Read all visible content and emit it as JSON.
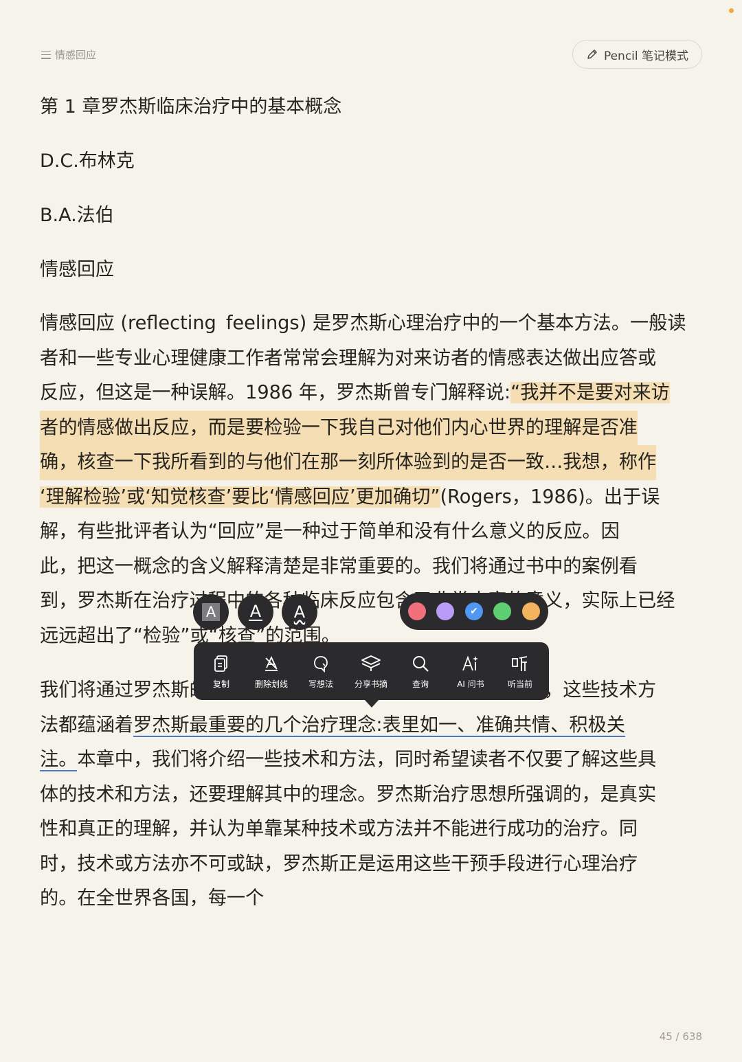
{
  "status": {
    "dot_color": "#f2a83b"
  },
  "header": {
    "chapter_label": "情感回应",
    "pencil_label": "Pencil 笔记模式"
  },
  "content": {
    "title": "第 1 章罗杰斯临床治疗中的基本概念",
    "author1": "D.C.布林克",
    "author2": "B.A.法伯",
    "section": "情感回应",
    "para1": [
      [
        "情感回应 (reflecting",
        "feelings) 是罗杰斯心理治疗中的一个基本方法。一般读"
      ],
      [
        "者和一些专业心理健康工作者常常会理解为对来访者的情感表达做出应答或"
      ],
      [
        "反应，但这是一种误解。1986 年，罗杰斯曾专门解释说:",
        "“我并不是要对来访"
      ],
      [
        "者的情感做出反应，而是要检验一下我自己对他们内心世界的理解是否准"
      ],
      [
        "确，核查一下我所看到的与他们在那一刻所体验到的是否一致…我想，称作"
      ],
      [
        "‘理解检验’或‘知觉核查’要比‘情感回应’更加确切”",
        "(Rogers，1986)。出于误"
      ],
      [
        "解，有些批评者认为“回应”是一种过于简单和没有什么意义的反应。因"
      ],
      [
        "此，把这一概念的含义解释清楚是非常重要的。我们将通过书中的案例看"
      ],
      [
        "到，罗杰斯在治疗过程中的各种临床反应包含了非常丰富的意义，实际上已经"
      ],
      [
        "远远超出了“检验”或“核查”的范围。"
      ]
    ],
    "para2": [
      [
        "我们将通过罗杰斯",
        "的治疗实例来说明罗杰斯的一些技术和概念，这些技术方"
      ],
      [
        "法都蕴涵着",
        "罗杰斯最重要的几个治疗理念:表里如一、准确共情、积极关"
      ],
      [
        "注。",
        "本章中，我们将介绍一些技术和方法，同时希望读者不仅要了解这些具"
      ],
      [
        "体的技术和方法，还要理解其中的理念。罗杰斯治疗思想所强调的，是真实"
      ],
      [
        "性和真正的理解，并认为单靠某种技术或方法并不能进行成功的治疗。同"
      ],
      [
        "时，技术或方法亦不可或缺，罗杰斯正是运用这些干预手段进行心理治疗"
      ],
      [
        "的。在全世界各国，每一个"
      ]
    ]
  },
  "styles": {
    "highlight_label": "A",
    "underline_label": "A",
    "wavy_label": "A"
  },
  "colors": {
    "swatches": [
      "#f1707c",
      "#b99cf5",
      "#4f97f0",
      "#5fcf73",
      "#f4b35e"
    ],
    "selected_index": 2,
    "highlight": "#f6deb4",
    "underline": "#4b77c9"
  },
  "toolbar": {
    "copy": "复制",
    "delete_underline": "删除划线",
    "write_idea": "写想法",
    "share_excerpt": "分享书摘",
    "lookup": "查询",
    "ai_ask": "AI 问书",
    "listen": "听当前"
  },
  "footer": {
    "page": "45 / 638"
  }
}
